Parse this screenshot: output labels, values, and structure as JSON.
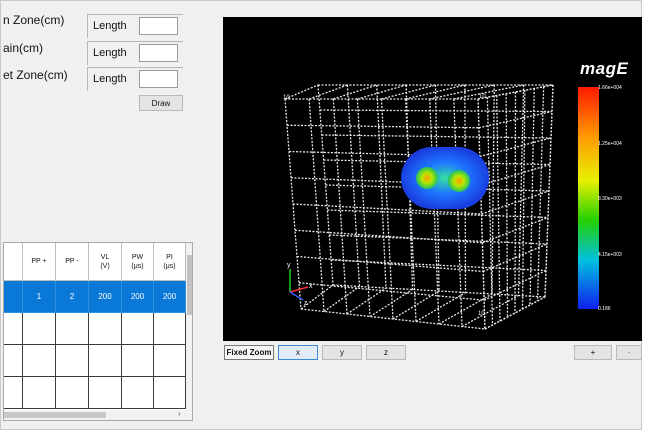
{
  "form": {
    "rows": [
      {
        "label": "n Zone(cm)",
        "length_label": "Length",
        "value": ""
      },
      {
        "label": "ain(cm)",
        "length_label": "Length",
        "value": ""
      },
      {
        "label": "et Zone(cm)",
        "length_label": "Length",
        "value": ""
      }
    ],
    "draw_label": "Draw"
  },
  "viewer": {
    "background": "#000000",
    "grid_color": "#ffffff",
    "colorbar": {
      "title": "magE",
      "ticks": [
        "1.66e+004",
        "1.25e+004",
        "8.30e+003",
        "4.15e+003",
        "0.186"
      ]
    },
    "axes_labels": [
      "y",
      "x",
      "z"
    ],
    "grid_labels": [
      "10",
      "10",
      "10"
    ]
  },
  "toolbar": {
    "fixed_zoom_label": "Fixed Zoom",
    "axis_buttons": [
      "x",
      "y",
      "z"
    ],
    "zoom_in_label": "+",
    "zoom_out_label": "-"
  },
  "table": {
    "columns": [
      "PP +",
      "PP -",
      "VL\n(V)",
      "PW\n(μs)",
      "PI\n(μs)"
    ],
    "rows": [
      [
        "1",
        "2",
        "200",
        "200",
        "200"
      ],
      [
        "",
        "",
        "",
        "",
        ""
      ],
      [
        "",
        "",
        "",
        "",
        ""
      ],
      [
        "",
        "",
        "",
        "",
        ""
      ]
    ]
  }
}
